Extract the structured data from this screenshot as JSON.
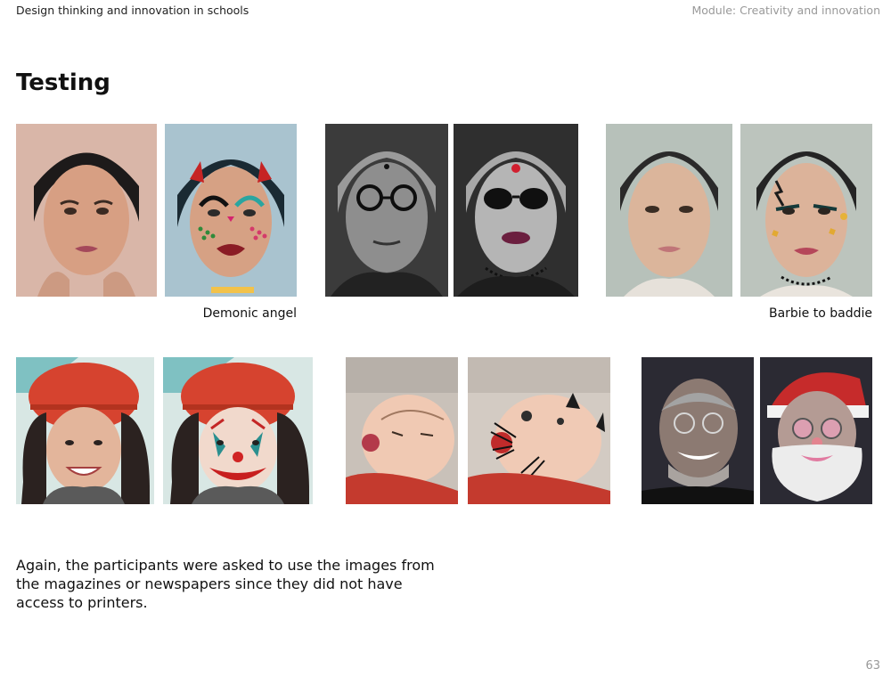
{
  "header": {
    "course": "Design thinking and innovation in schools",
    "module": "Module: Creativity and innovation"
  },
  "title": "Testing",
  "captions": {
    "demonic_angel": "Demonic angel",
    "barbie_to_baddie": "Barbie to baddie"
  },
  "body_text": "Again, the participants were asked to use the images from the magazines or newspapers since they did not have access to printers.",
  "page_number": "63"
}
